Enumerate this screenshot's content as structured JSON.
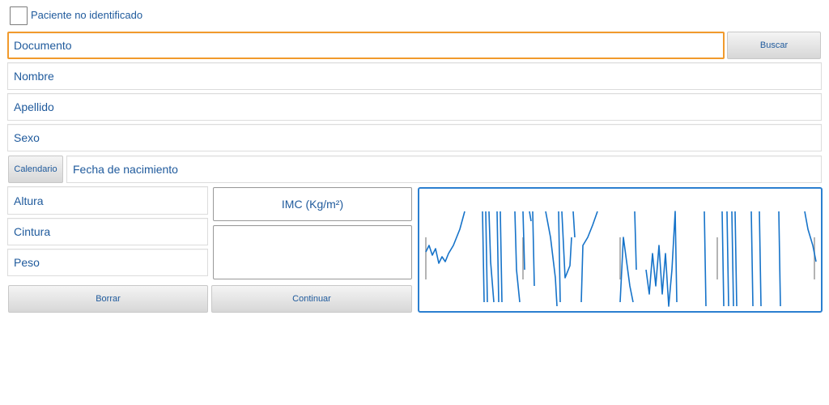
{
  "patient": {
    "unidentified_label": "Paciente no identificado",
    "unidentified_checked": false
  },
  "fields": {
    "document_placeholder": "Documento",
    "name_placeholder": "Nombre",
    "surname_placeholder": "Apellido",
    "sex_placeholder": "Sexo",
    "birthdate_placeholder": "Fecha de nacimiento",
    "height_placeholder": "Altura",
    "waist_placeholder": "Cintura",
    "weight_placeholder": "Peso",
    "imc_label": "IMC (Kg/m²)",
    "imc_value": ""
  },
  "buttons": {
    "search_label": "Buscar",
    "calendar_label": "Calendario",
    "clear_label": "Borrar",
    "continue_label": "Continuar"
  },
  "waveform": {
    "color": "#1673c9",
    "marker_color": "#9a9a9a"
  }
}
